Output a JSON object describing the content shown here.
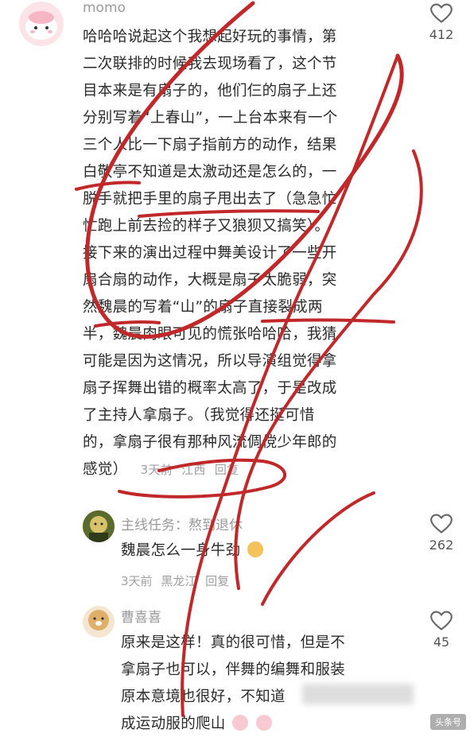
{
  "comments": [
    {
      "user": "momo",
      "lines": [
        "哈哈哈说起这个我想起好玩的事情，第",
        "二次联排的时候我去现场看了，这个节",
        "目本来是有扇子的，他们仨的扇子上还",
        "分别写着“上春山”，一上台本来有一个",
        "三个人比一下扇子指前方的动作，结果",
        "白敬亭不知道是太激动还是怎么的，一",
        "脱手就把手里的扇子甩出去了（急急忙",
        "忙跑上前去捡的样子又狼狈又搞笑）。",
        "接下来的演出过程中舞美设计了一些开",
        "扇合扇的动作，大概是扇子太脆弱，突",
        "然魏晨的写着“山”的扇子直接裂成两",
        "半，魏晨肉眼可见的慌张哈哈哈，我猜",
        "可能是因为这情况，所以导演组觉得拿",
        "扇子挥舞出错的概率太高了，于是改成",
        "了主持人拿扇子。（我觉得还挺可惜",
        "的，拿扇子很有那种风流倜傥少年郎的",
        "感觉）"
      ],
      "time": "3天前",
      "location": "江西",
      "reply": "回复",
      "likes": "412"
    },
    {
      "user": "主线任务：熬到退休",
      "lines": [
        "魏晨怎么一身牛劲"
      ],
      "time": "3天前",
      "location": "黑龙江",
      "reply": "回复",
      "likes": "262"
    },
    {
      "user": "曹喜喜",
      "lines": [
        "原来是这样！真的很可惜，但是不",
        "拿扇子也可以，伴舞的编舞和服装",
        "原本意境也很好，不知道",
        "成运动服的爬山"
      ],
      "likes": "45"
    }
  ],
  "watermark": "头条号",
  "colors": {
    "annotation": "#c0282a",
    "text": "#2a2a2a",
    "meta": "#a0a0a0"
  },
  "icons": [
    "heart-outline-icon",
    "crying-face-emoji",
    "dog-face-emoji"
  ]
}
